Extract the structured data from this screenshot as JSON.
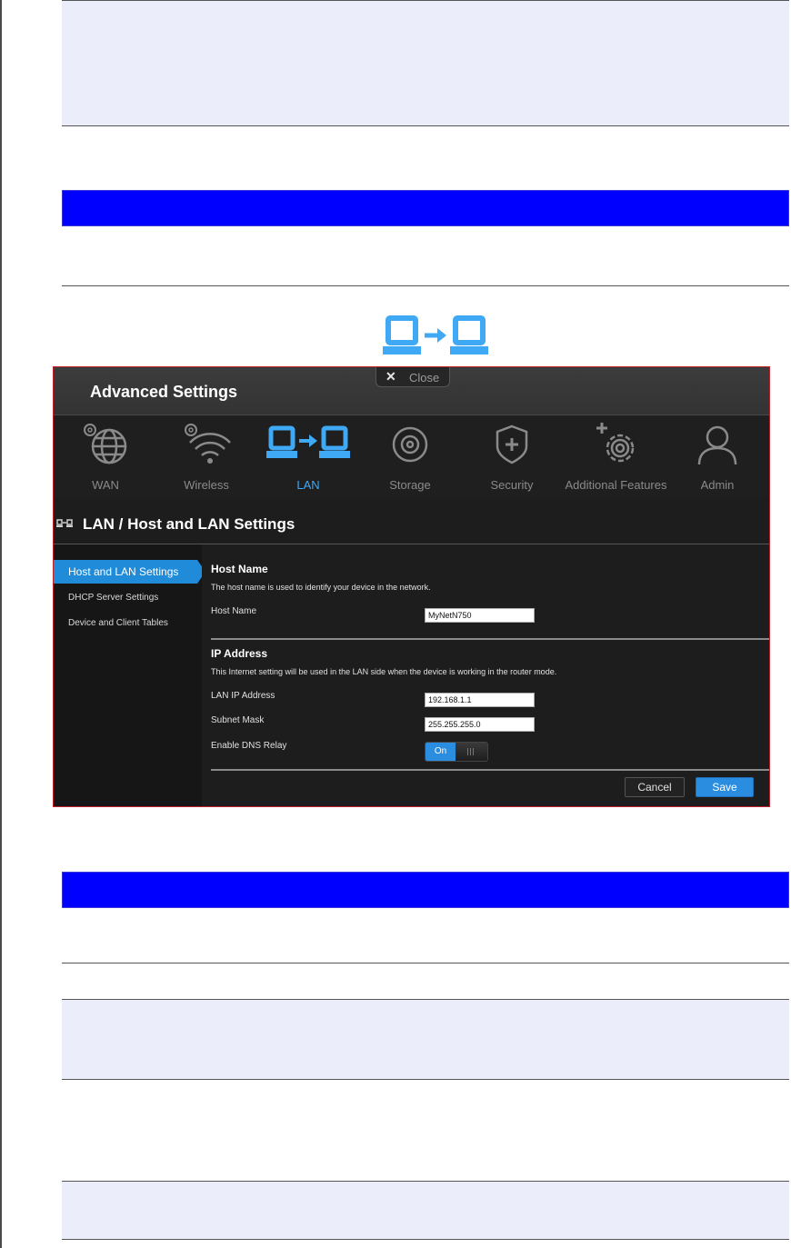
{
  "window": {
    "title": "Advanced Settings",
    "close_label": "Close"
  },
  "nav": {
    "items": [
      {
        "label": "WAN",
        "icon": "globe-gear-icon"
      },
      {
        "label": "Wireless",
        "icon": "wifi-gear-icon"
      },
      {
        "label": "LAN",
        "icon": "lan-icon"
      },
      {
        "label": "Storage",
        "icon": "disc-icon"
      },
      {
        "label": "Security",
        "icon": "shield-plus-icon"
      },
      {
        "label": "Additional Features",
        "icon": "gear-plus-icon"
      },
      {
        "label": "Admin",
        "icon": "user-icon"
      }
    ],
    "active": "LAN"
  },
  "page": {
    "heading": "LAN / Host and LAN Settings"
  },
  "sidebar": {
    "items": [
      {
        "label": "Host and LAN Settings"
      },
      {
        "label": "DHCP Server Settings"
      },
      {
        "label": "Device and Client Tables"
      }
    ]
  },
  "host_section": {
    "title": "Host Name",
    "description": "The host name is used to identify your device in the network.",
    "host_name_label": "Host Name",
    "host_name_value": "MyNetN750"
  },
  "ip_section": {
    "title": "IP Address",
    "description": "This Internet setting will be used in the LAN side when the device is working in the router mode.",
    "lan_ip_label": "LAN IP Address",
    "lan_ip_value": "192.168.1.1",
    "subnet_label": "Subnet Mask",
    "subnet_value": "255.255.255.0",
    "dns_relay_label": "Enable DNS Relay",
    "dns_relay_state": "On"
  },
  "actions": {
    "cancel_label": "Cancel",
    "save_label": "Save"
  },
  "colors": {
    "accent": "#2a8de0",
    "section_bar": "#0000ff",
    "frame_border": "#c0202a"
  }
}
